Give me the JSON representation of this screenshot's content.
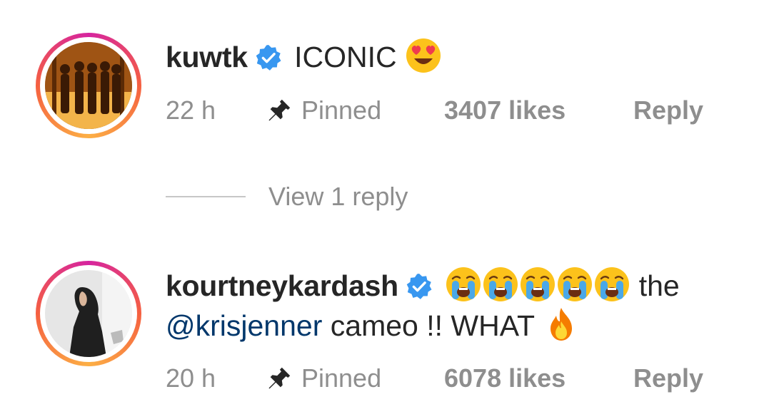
{
  "comments": [
    {
      "username": "kuwtk",
      "text": "ICONIC",
      "emojis": [
        "heart-eyes-emoji"
      ],
      "time": "22 h",
      "pinned_label": "Pinned",
      "likes": "3407 likes",
      "reply_label": "Reply"
    },
    {
      "username": "kourtneykardash",
      "text_after_emojis": "the",
      "mention": "@krisjenner",
      "text_rest": "cameo !! WHAT",
      "emojis": [
        "crying-emoji",
        "crying-emoji",
        "crying-emoji",
        "crying-emoji",
        "crying-emoji",
        "fire-emoji"
      ],
      "time": "20 h",
      "pinned_label": "Pinned",
      "likes": "6078 likes",
      "reply_label": "Reply"
    }
  ],
  "view_replies_label": "View 1 reply",
  "colors": {
    "verified": "#3897f0",
    "meta_text": "#8e8e8e",
    "mention": "#00376b"
  }
}
